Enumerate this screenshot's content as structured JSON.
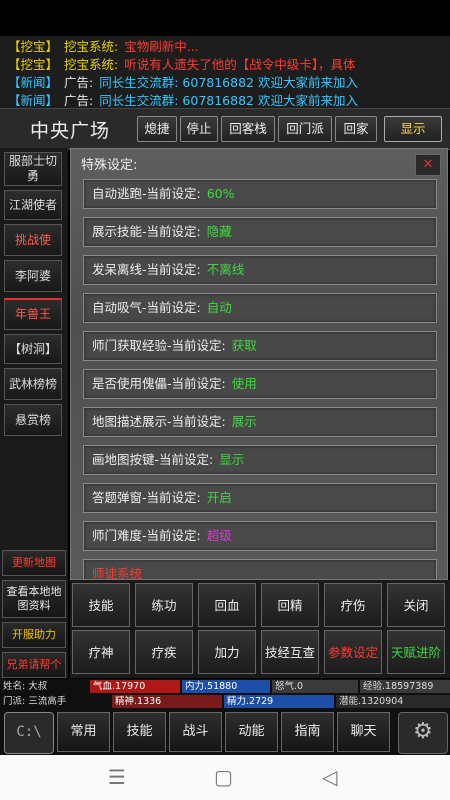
{
  "news": [
    {
      "tag": "【挖宝】",
      "tag_color": "yellow",
      "label": "挖宝系统:",
      "label_color": "yellow",
      "msg": "宝物刷新中...",
      "msg_color": "red"
    },
    {
      "tag": "【挖宝】",
      "tag_color": "yellow",
      "label": "挖宝系统:",
      "label_color": "yellow",
      "msg": "听说有人遗失了他的【战令中级卡】，具体",
      "msg_color": "red"
    },
    {
      "tag": "【新闻】",
      "tag_color": "cyan",
      "label": "广告:",
      "label_color": "white",
      "msg": "同长生交流群: 607816882 欢迎大家前来加入",
      "msg_color": "cyan"
    },
    {
      "tag": "【新闻】",
      "tag_color": "cyan",
      "label": "广告:",
      "label_color": "white",
      "msg": "同长生交流群: 607816882 欢迎大家前来加入",
      "msg_color": "cyan"
    }
  ],
  "location": "中央广场",
  "topbar": {
    "pause": "熄捷",
    "stop": "停止",
    "inn": "回客栈",
    "sect": "回门派",
    "home": "回家",
    "show": "显示"
  },
  "left_menu": [
    "服部士切勇",
    "江湖使者",
    "挑战使",
    "李阿婆",
    "年兽王",
    "【树洞】",
    "武林榜榜",
    "悬赏榜"
  ],
  "panel_title": "特殊设定:",
  "close_icon": "✕",
  "settings": [
    {
      "label": "自动逃跑-当前设定:",
      "value": "60%",
      "color": "green"
    },
    {
      "label": "展示技能-当前设定:",
      "value": "隐藏",
      "color": "green"
    },
    {
      "label": "发呆离线-当前设定:",
      "value": "不离线",
      "color": "green"
    },
    {
      "label": "自动吸气-当前设定:",
      "value": "自动",
      "color": "green"
    },
    {
      "label": "师门获取经验-当前设定:",
      "value": "获取",
      "color": "green"
    },
    {
      "label": "是否使用傀儡-当前设定:",
      "value": "使用",
      "color": "green"
    },
    {
      "label": "地图描述展示-当前设定:",
      "value": "展示",
      "color": "green"
    },
    {
      "label": "画地图按键-当前设定:",
      "value": "显示",
      "color": "green"
    },
    {
      "label": "答题弹窗-当前设定:",
      "value": "开启",
      "color": "green"
    },
    {
      "label": "师门难度-当前设定:",
      "value": "超级",
      "color": "purple"
    },
    {
      "label": "师徒系统",
      "value": "",
      "color": "red"
    }
  ],
  "left_bottom": [
    {
      "label": "更新地图",
      "color": "#ff3b30"
    },
    {
      "label": "查看本地地图资料",
      "color": "#e8e8e8"
    },
    {
      "label": "开服助力",
      "color": "#f0c400"
    },
    {
      "label": "兄弟请帮个",
      "color": "#ff3b30"
    }
  ],
  "actions_row1": [
    {
      "label": "技能",
      "color": "white"
    },
    {
      "label": "练功",
      "color": "white"
    },
    {
      "label": "回血",
      "color": "white"
    },
    {
      "label": "回精",
      "color": "white"
    },
    {
      "label": "疗伤",
      "color": "white"
    },
    {
      "label": "关闭",
      "color": "white"
    }
  ],
  "actions_row2": [
    {
      "label": "疗神",
      "color": "white"
    },
    {
      "label": "疗疾",
      "color": "white"
    },
    {
      "label": "加力",
      "color": "white"
    },
    {
      "label": "技经互查",
      "color": "white"
    },
    {
      "label": "参数设定",
      "color": "red"
    },
    {
      "label": "天赋进阶",
      "color": "green"
    }
  ],
  "stats": {
    "name": "姓名: 大叔",
    "hp": "气血.17970",
    "neili": "内力.51880",
    "nuqi": "怒气.0",
    "exp": "经验.18597389",
    "school": "门派: 三流高手",
    "jingshen": "精神.1336",
    "jingli": "精力.2729",
    "qianneng": "潜能.1320904"
  },
  "bottom_buttons": [
    "常用",
    "技能",
    "战斗",
    "动能",
    "指南",
    "聊天"
  ],
  "cmd_label": "C:\\",
  "gear_icon": "⚙",
  "nav_icons": [
    "☰",
    "▢",
    "◁"
  ]
}
